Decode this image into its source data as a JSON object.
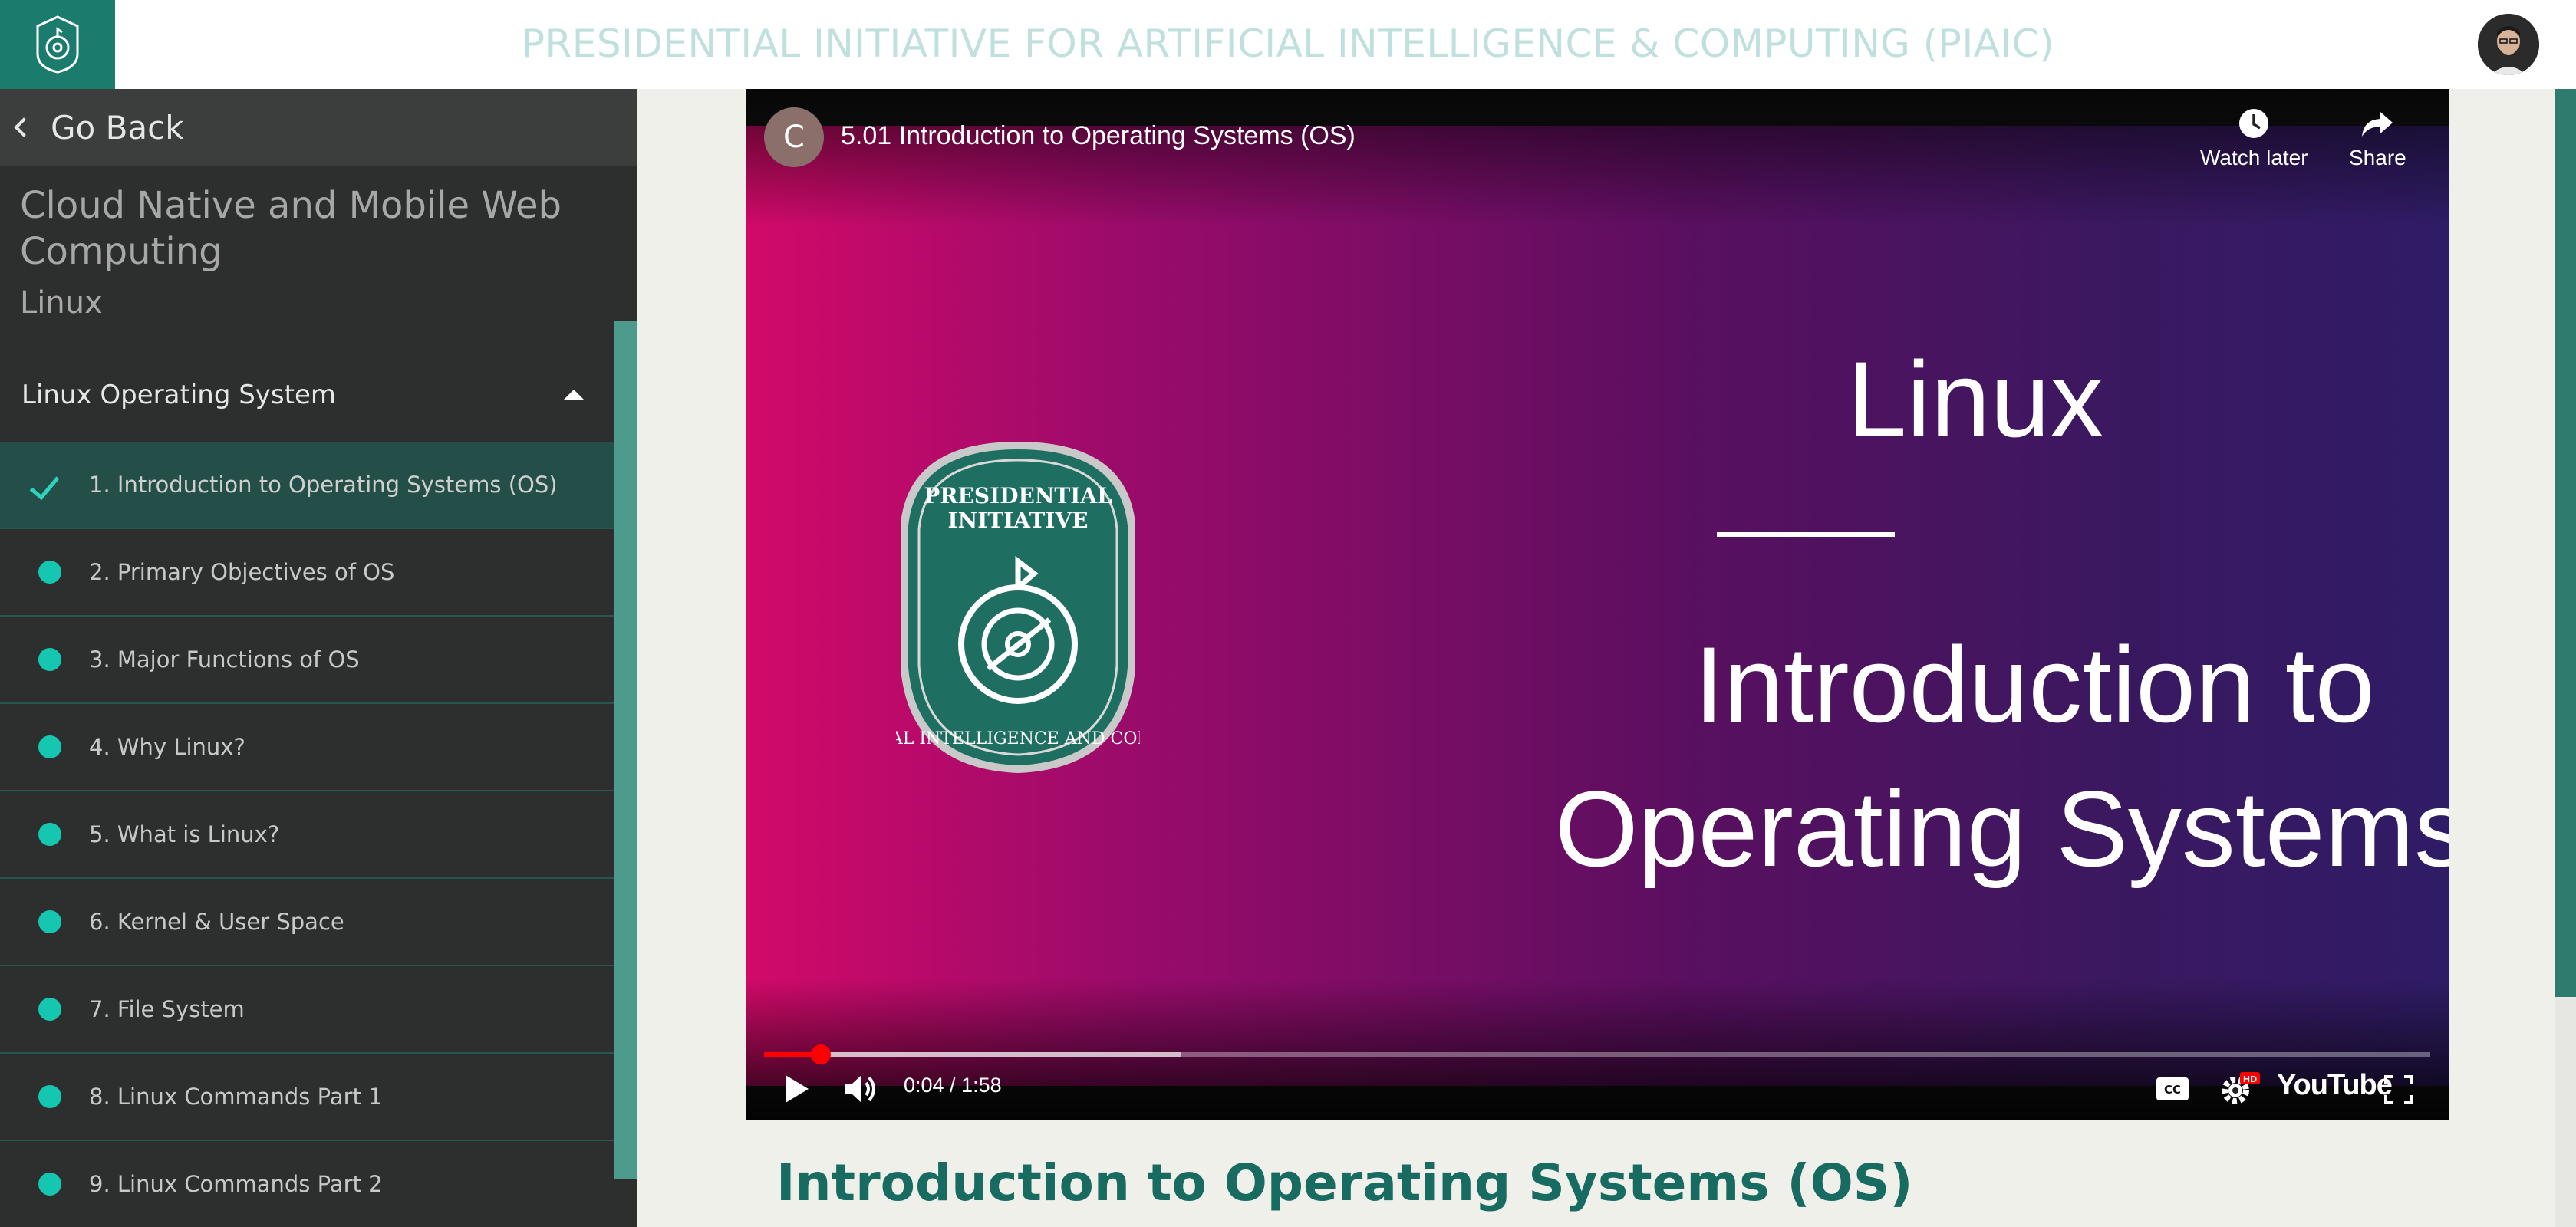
{
  "header": {
    "site_title": "PRESIDENTIAL INITIATIVE FOR ARTIFICIAL INTELLIGENCE & COMPUTING (PIAIC)",
    "logo_icon": "piaic-logo-icon",
    "avatar_icon": "user-avatar"
  },
  "sidebar": {
    "go_back_label": "Go Back",
    "course_title": "Cloud Native and Mobile Web Computing",
    "course_subtitle": "Linux",
    "section_title": "Linux Operating System",
    "lessons": [
      {
        "label": "1. Introduction to Operating Systems (OS)",
        "status": "completed"
      },
      {
        "label": "2. Primary Objectives of OS",
        "status": "pending"
      },
      {
        "label": "3. Major Functions of OS",
        "status": "pending"
      },
      {
        "label": "4. Why Linux?",
        "status": "pending"
      },
      {
        "label": "5. What is Linux?",
        "status": "pending"
      },
      {
        "label": "6. Kernel & User Space",
        "status": "pending"
      },
      {
        "label": "7. File System",
        "status": "pending"
      },
      {
        "label": "8. Linux Commands Part 1",
        "status": "pending"
      },
      {
        "label": "9. Linux Commands Part 2",
        "status": "pending"
      }
    ]
  },
  "video": {
    "channel_initial": "C",
    "title": "5.01 Introduction to Operating Systems (OS)",
    "watch_later_label": "Watch later",
    "share_label": "Share",
    "slide": {
      "line1": "Linux",
      "line2": "Introduction to",
      "line3": "Operating Systems",
      "badge_top": "PRESIDENTIAL INITIATIVE",
      "badge_ring": "ARTIFICIAL INTELLIGENCE AND COMPUTING"
    },
    "time_display": "0:04 / 1:58",
    "progress_played_fraction": 0.034,
    "progress_buffered_fraction": 0.25,
    "youtube_label": "YouTube",
    "hd_badge": "HD"
  },
  "main": {
    "lesson_heading": "Introduction to Operating Systems (OS)"
  },
  "colors": {
    "brand_teal": "#1b7b6c",
    "sidebar_bg": "#2d2f2f",
    "active_lesson_bg": "#234f48",
    "status_dot": "#15c7b0",
    "heading_teal": "#176b60"
  }
}
